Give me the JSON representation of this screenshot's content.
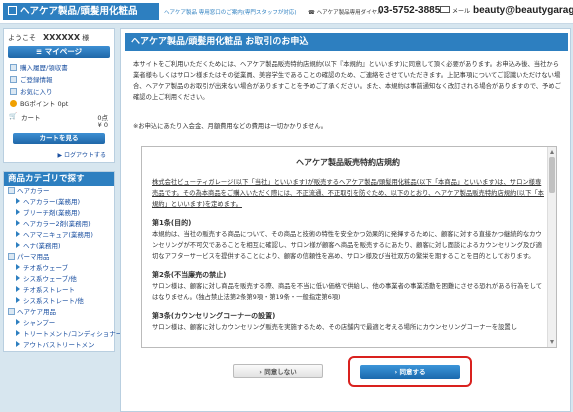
{
  "header": {
    "logo": "ヘアケア製品/頭髪用化粧品",
    "subtitle": "ヘアケア製品 専用窓口のご案内(専門スタッフが対応)",
    "phone_label": "ヘアケア製品専用ダイヤル",
    "phone": "03-5752-3885",
    "mail_label": "メール",
    "email": "beauty@beautygarage.jp"
  },
  "sidebar": {
    "welcome_prefix": "ようこそ",
    "user_name": "XXXXXX",
    "welcome_suffix": "様",
    "mypage_label": "マイページ",
    "links": [
      "購入履歴/領収書",
      "ご登録情報",
      "お気に入り"
    ],
    "points_label": "BGポイント 0pt",
    "cart_label": "カート",
    "cart_count": "0点",
    "cart_total": "¥ 0",
    "cart_button": "カートを見る",
    "logout": "ログアウトする"
  },
  "categories": {
    "title": "商品カテゴリで探す",
    "items": [
      {
        "label": "ヘアカラー",
        "level": 0
      },
      {
        "label": "ヘアカラー(業務用)",
        "level": 1
      },
      {
        "label": "ブリーチ剤(業務用)",
        "level": 1
      },
      {
        "label": "ヘアカラー2剤(業務用)",
        "level": 1
      },
      {
        "label": "ヘアマニキュア(業務用)",
        "level": 1
      },
      {
        "label": "ヘナ(業務用)",
        "level": 1
      },
      {
        "label": "パーマ用品",
        "level": 0
      },
      {
        "label": "チオ系ウェーブ",
        "level": 1
      },
      {
        "label": "シス系ウェーブ/他",
        "level": 1
      },
      {
        "label": "チオ系ストレート",
        "level": 1
      },
      {
        "label": "シス系ストレート/他",
        "level": 1
      },
      {
        "label": "ヘアケア用品",
        "level": 0
      },
      {
        "label": "シャンプー",
        "level": 1
      },
      {
        "label": "トリートメント/コンディショナー",
        "level": 1
      },
      {
        "label": "アウトバストリートメン",
        "level": 1
      }
    ]
  },
  "main": {
    "title": "ヘアケア製品/頭髪用化粧品 お取引のお申込",
    "intro": "本サイトをご利用いただくためには、ヘアケア製品販売特約店規約(以下『本規約』といいます)に同意して頂く必要があります。お申込み後、当社から業者様もしくはサロン様またはその従業員、美容学生であることの確認のため、ご連絡をさせていただきます。上記事項についてご認識いただけない場合、ヘアケア製品のお取引が出来ない場合がありますことを予めご了承ください。また、本規約は事前通知なく改訂される場合がありますので、予めご確認の上ご利用ください。",
    "note": "※お申込にあたり入会金、月額費用などの費用は一切かかりません。",
    "terms": {
      "title": "ヘアケア製品販売特約店規約",
      "preamble": "株式会社ビューティガレージ(以下「当社」といいます)が販売するヘアケア製品/頭髪用化粧品(以下「本商品」といいます)は、サロン様専売品です。その為本商品をご購入いただく際には、不正流通、不正取引を防ぐため、以下のとおり、ヘアケア製品販売特約店規約(以下「本規約」といいます)を定めます。",
      "articles": [
        {
          "heading": "第1条(目的)",
          "body": "本規約は、当社の販売する商品について、その商品と技術の特性を安全かつ効果的に発揮するために、顧客に対する直接かつ継続的なカウンセリングが不可欠であることを相互に確認し、サロン様が顧客へ商品を販売するにあたり、顧客に対し面談によるカウンセリング及び適切なアフターサービスを提供することにより、顧客の信頼性を高め、サロン様及び当社双方の繁栄を期することを目的としております。"
        },
        {
          "heading": "第2条(不当廉売の禁止)",
          "body": "サロン様は、顧客に対し商品を販売する際、商品を不当に低い価格で供給し、他の事業者の事業活動を困難にさせる恐れがある行為をしてはなりません。(独占禁止法第2条第9項・第19条・一般指定第6項)"
        },
        {
          "heading": "第3条(カウンセリングコーナーの設置)",
          "body": "サロン様は、顧客に対しカウンセリング販売を実施するため、その店舗内で最適と考える場所にカウンセリングコーナーを設置し"
        }
      ]
    },
    "disagree_label": "› 同意しない",
    "agree_label": "› 同意する"
  }
}
